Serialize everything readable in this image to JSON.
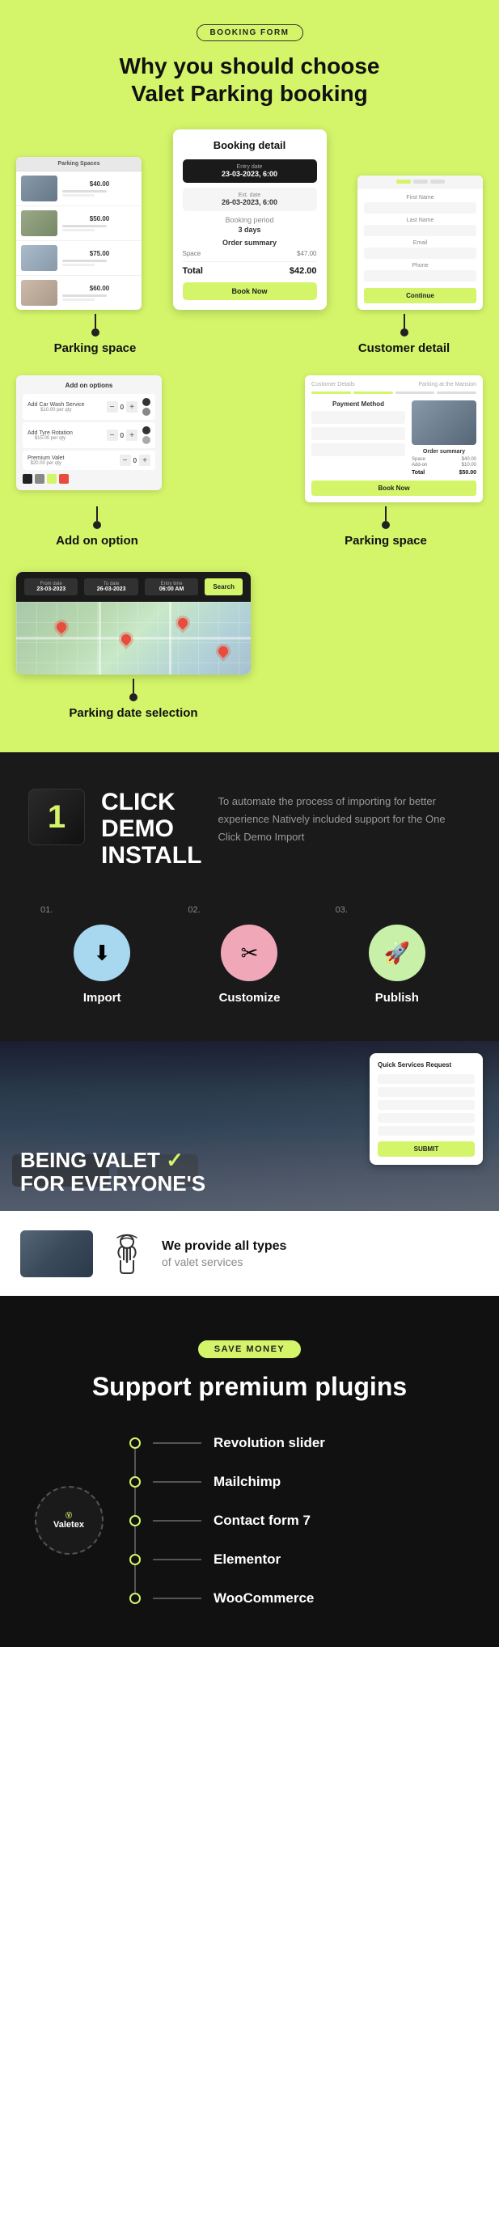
{
  "page": {
    "sections": {
      "why": {
        "badge": "BOOKING FORM",
        "title_line1": "Why you should choose",
        "title_line2": "Valet Parking booking",
        "screenshots": {
          "parking_label": "Parking space",
          "booking_title": "Booking detail",
          "customer_label": "Customer detail",
          "addon_label": "Add on option",
          "parking2_label": "Parking space",
          "date_label": "Parking date selection",
          "booking_fields": {
            "entry_label": "Entry date",
            "entry_value": "23-03-2023, 6:00",
            "exit_label": "Ext. date",
            "exit_value": "26-03-2023, 6:00",
            "period_label": "Booking period",
            "period_value": "3 days",
            "summary_label": "Order summary",
            "item_name": "Space",
            "item_price": "$47.00",
            "total_label": "Total",
            "total_value": "$42.00",
            "btn": "Book Now"
          }
        }
      },
      "demo": {
        "number": "1",
        "title_line1": "CLICK",
        "title_line2": "DEMO",
        "title_line3": "INSTALL",
        "description": "To automate the process of importing for better experience Natively included support for the One Click Demo Import",
        "steps": [
          {
            "num": "01.",
            "label": "Import",
            "icon": "⬇"
          },
          {
            "num": "02.",
            "label": "Customize",
            "icon": "✂"
          },
          {
            "num": "03.",
            "label": "Publish",
            "icon": "🚀"
          }
        ]
      },
      "valet": {
        "hero_line1": "BEING VALET",
        "hero_highlight": "✓",
        "hero_line2": "FOR EVERYONE'S",
        "quick_card_title": "Quick Services Request",
        "quick_card_btn": "SUBMIT",
        "service_title": "We provide all types",
        "service_sub": "of valet services"
      },
      "plugins": {
        "badge": "SAVE MONEY",
        "title": "Support premium plugins",
        "logo_text": "Valetex",
        "items": [
          {
            "name": "Revolution slider"
          },
          {
            "name": "Mailchimp"
          },
          {
            "name": "Contact form 7"
          },
          {
            "name": "Elementor"
          },
          {
            "name": "WooCommerce"
          }
        ]
      }
    }
  }
}
